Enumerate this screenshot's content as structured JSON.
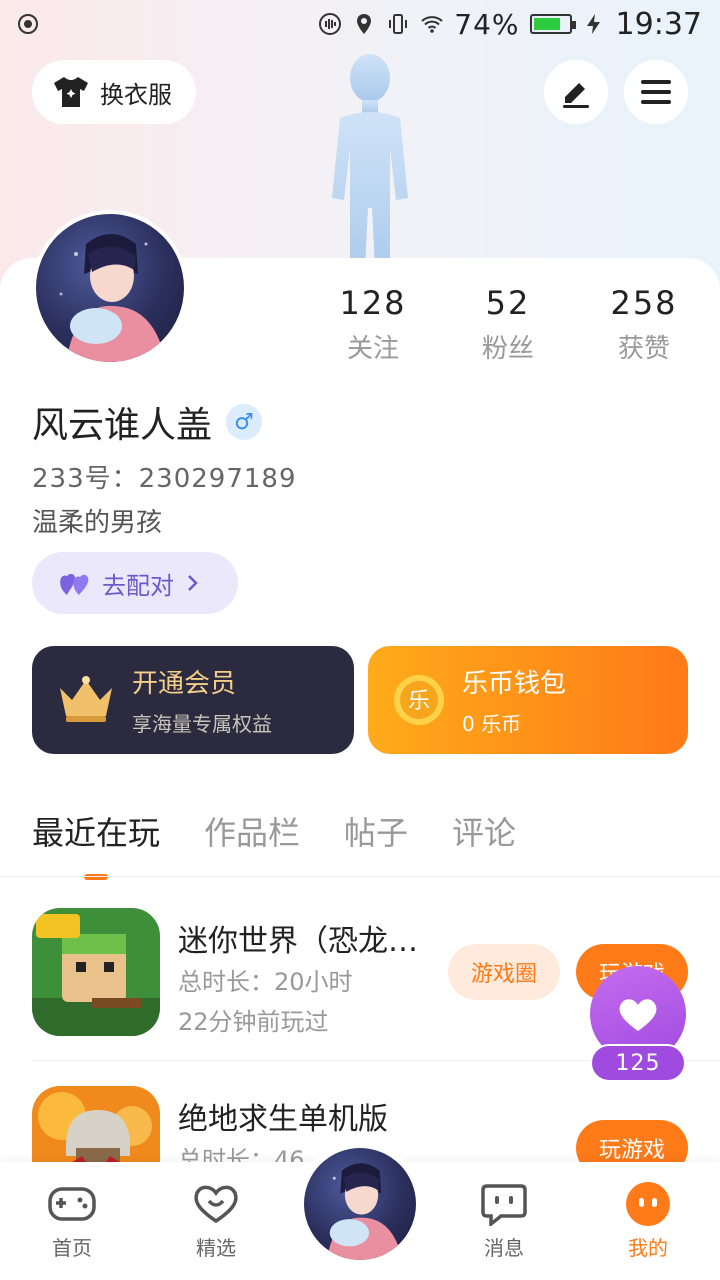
{
  "status_bar": {
    "battery_pct": "74%",
    "time": "19:37"
  },
  "header": {
    "outfit_label": "换衣服",
    "icons": [
      "tshirt-icon",
      "edit-icon",
      "menu-icon"
    ]
  },
  "profile": {
    "stats": [
      {
        "value": "128",
        "label": "关注"
      },
      {
        "value": "52",
        "label": "粉丝"
      },
      {
        "value": "258",
        "label": "获赞"
      }
    ],
    "username": "风云谁人盖",
    "gender_symbol": "♂",
    "uid": "233号：230297189",
    "bio": "温柔的男孩",
    "match_label": "去配对"
  },
  "promos": {
    "vip": {
      "title": "开通会员",
      "subtitle": "享海量专属权益"
    },
    "wallet": {
      "title": "乐币钱包",
      "subtitle": "0 乐币",
      "coin_glyph": "乐"
    }
  },
  "tabs": [
    "最近在玩",
    "作品栏",
    "帖子",
    "评论"
  ],
  "games": [
    {
      "name": "迷你世界（恐龙…",
      "duration": "总时长：20小时",
      "last_played": "22分钟前玩过",
      "circle_label": "游戏圈",
      "play_label": "玩游戏"
    },
    {
      "name": "绝地求生单机版",
      "duration": "总时长：46",
      "play_label": "玩游戏"
    }
  ],
  "like_fab": {
    "count": "125"
  },
  "bottom_nav": [
    {
      "label": "首页",
      "icon": "gamepad-icon"
    },
    {
      "label": "精选",
      "icon": "heart-smile-icon"
    },
    {
      "label": "消息",
      "icon": "chat-icon"
    },
    {
      "label": "我的",
      "icon": "face-icon"
    }
  ],
  "colors": {
    "accent": "#ff7a18",
    "vip_bg": "#2b2a3e",
    "match_bg": "#ebe8fb",
    "like_purple": "#a04be0"
  }
}
